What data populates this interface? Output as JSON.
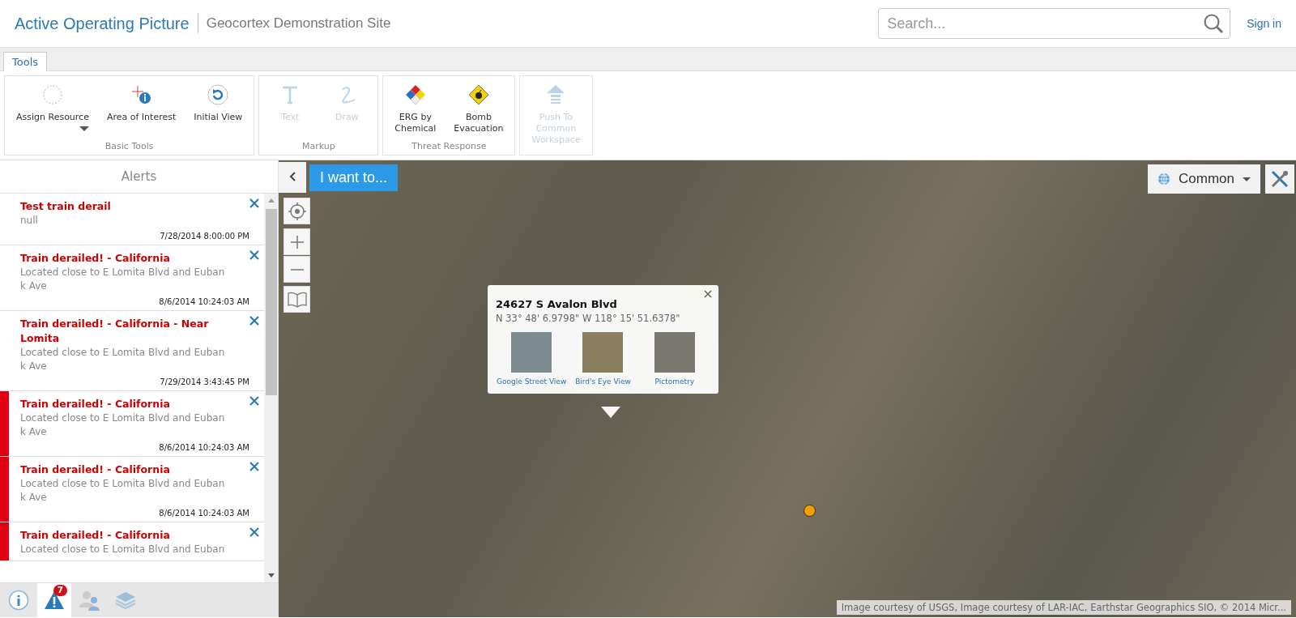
{
  "header": {
    "title": "Active Operating Picture",
    "site": "Geocortex Demonstration Site",
    "search": {
      "placeholder": "Search..."
    },
    "sign_in": "Sign in"
  },
  "tabs": [
    {
      "label": "Tools",
      "selected": true
    }
  ],
  "toolbar_groups": [
    {
      "title": "Basic Tools",
      "buttons": [
        {
          "kind": "assign",
          "label": "Assign Resource",
          "disabled": false,
          "dropdown": true
        },
        {
          "kind": "area",
          "label": "Area of Interest",
          "disabled": false,
          "dropdown": false
        },
        {
          "kind": "initial",
          "label": "Initial View",
          "disabled": false,
          "dropdown": false
        }
      ]
    },
    {
      "title": "Markup",
      "buttons": [
        {
          "kind": "text",
          "label": "Text",
          "disabled": true,
          "dropdown": false
        },
        {
          "kind": "draw",
          "label": "Draw",
          "disabled": true,
          "dropdown": false
        }
      ]
    },
    {
      "title": "Threat Response",
      "buttons": [
        {
          "kind": "erg",
          "label": "ERG by\nChemical",
          "disabled": false,
          "dropdown": false
        },
        {
          "kind": "bomb",
          "label": "Bomb\nEvacuation",
          "disabled": false,
          "dropdown": false
        }
      ]
    },
    {
      "buttons": [
        {
          "kind": "push",
          "label": "Push To\nCommon\nWorkspace",
          "disabled": true,
          "dropdown": false
        }
      ]
    }
  ],
  "alerts": {
    "title": "Alerts",
    "items": [
      {
        "title": "Test train derail",
        "description": "null",
        "time": "7/28/2014 8:00:00 PM",
        "highlighted": false
      },
      {
        "title": "Train derailed! - California",
        "description": "Located close to E Lomita Blvd and Euban\nk Ave",
        "time": "8/6/2014 10:24:03 AM",
        "highlighted": false
      },
      {
        "title": "Train derailed! - California - Near Lomita",
        "description": "Located close to E Lomita Blvd and Euban\nk Ave",
        "time": "7/29/2014 3:43:45 PM",
        "highlighted": false
      },
      {
        "title": "Train derailed! - California",
        "description": "Located close to E Lomita Blvd and Euban\nk Ave",
        "time": "8/6/2014 10:24:03 AM",
        "highlighted": true
      },
      {
        "title": "Train derailed! - California",
        "description": "Located close to E Lomita Blvd and Euban\nk Ave",
        "time": "8/6/2014 10:24:03 AM",
        "highlighted": true
      },
      {
        "title": "Train derailed! - California",
        "description": "Located close to E Lomita Blvd and Euban",
        "highlighted": true
      }
    ]
  },
  "panel_tabs": [
    {
      "kind": "info",
      "selected": false
    },
    {
      "kind": "alerts",
      "selected": true,
      "badge": "7"
    },
    {
      "kind": "people",
      "selected": false
    },
    {
      "kind": "layers",
      "selected": false
    }
  ],
  "map": {
    "i_want_to": "I want to...",
    "basemap": "Common",
    "popup": {
      "title": "24627 S Avalon Blvd",
      "coordinates": "N 33° 48' 6.9798\" W 118° 15' 51.6378\"",
      "links": [
        "Google Street View",
        "Bird's Eye View",
        "Pictometry"
      ]
    },
    "attribution": "Image courtesy of USGS, Image courtesy of LAR-IAC, Earthstar Geographics SIO, © 2014 Micr..."
  }
}
